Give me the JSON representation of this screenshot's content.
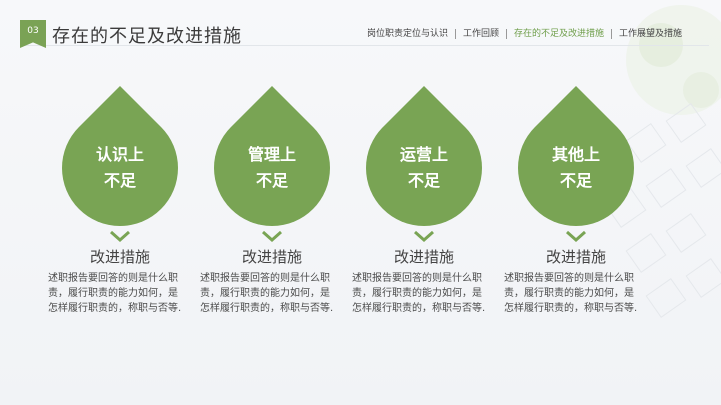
{
  "badge": "03",
  "title": "存在的不足及改进措施",
  "nav": [
    {
      "label": "岗位职责定位与认识",
      "active": false
    },
    {
      "label": "工作回顾",
      "active": false
    },
    {
      "label": "存在的不足及改进措施",
      "active": true
    },
    {
      "label": "工作展望及措施",
      "active": false
    }
  ],
  "cards": [
    {
      "line1": "认识上",
      "line2": "不足",
      "heading": "改进措施",
      "desc": "述职报告要回答的则是什么职责，履行职责的能力如何，是怎样履行职责的，称职与否等."
    },
    {
      "line1": "管理上",
      "line2": "不足",
      "heading": "改进措施",
      "desc": "述职报告要回答的则是什么职责，履行职责的能力如何，是怎样履行职责的，称职与否等."
    },
    {
      "line1": "运营上",
      "line2": "不足",
      "heading": "改进措施",
      "desc": "述职报告要回答的则是什么职责，履行职责的能力如何，是怎样履行职责的，称职与否等."
    },
    {
      "line1": "其他上",
      "line2": "不足",
      "heading": "改进措施",
      "desc": "述职报告要回答的则是什么职责，履行职责的能力如何，是怎样履行职责的，称职与否等."
    }
  ],
  "colors": {
    "accent": "#79a454",
    "active_nav": "#6e9e4a"
  },
  "icons": {
    "card_arrow": "chevron-down-icon"
  }
}
